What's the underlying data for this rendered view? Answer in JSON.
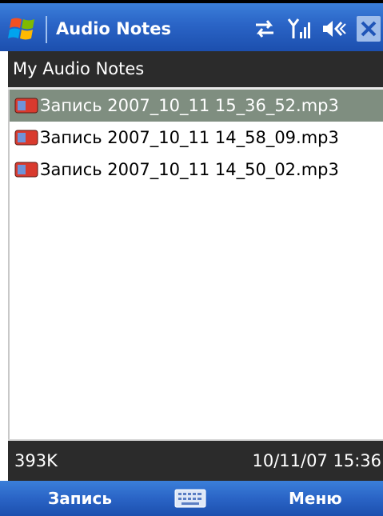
{
  "titlebar": {
    "title": "Audio Notes"
  },
  "folder": {
    "title": "My Audio Notes"
  },
  "files": [
    {
      "name": "Запись 2007_10_11 15_36_52.mp3",
      "selected": true
    },
    {
      "name": "Запись 2007_10_11 14_58_09.mp3",
      "selected": false
    },
    {
      "name": "Запись 2007_10_11 14_50_02.mp3",
      "selected": false
    }
  ],
  "status": {
    "size": "393K",
    "datetime": "10/11/07 15:36"
  },
  "softkeys": {
    "left": "Запись",
    "right": "Меню"
  },
  "icons": {
    "start": "windows-flag-icon",
    "sync": "sync-arrows-icon",
    "signal": "signal-strength-icon",
    "volume": "speaker-icon",
    "close": "close-icon",
    "file": "audio-file-icon",
    "keyboard": "keyboard-icon"
  },
  "colors": {
    "titlebar": "#2a64c6",
    "header_bg": "#2b2b2b",
    "selection": "#7f8e80"
  }
}
